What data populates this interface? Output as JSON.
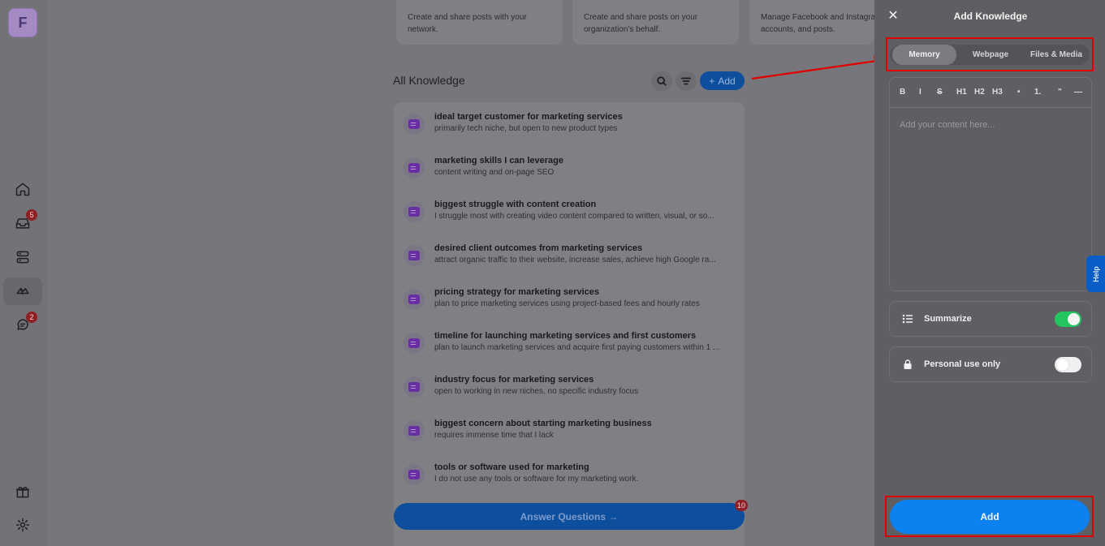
{
  "rail": {
    "logo_letter": "F",
    "inbox_badge": "5",
    "chat_badge": "2"
  },
  "cards": [
    {
      "text": "Create and share posts with your network."
    },
    {
      "text": "Create and share posts on your organization's behalf."
    },
    {
      "text": "Manage Facebook and Instagram pages, accounts, and posts."
    }
  ],
  "knowledge": {
    "title": "All Knowledge",
    "add_label": "Add",
    "items": [
      {
        "title": "ideal target customer for marketing services",
        "subtitle": "primarily tech niche, but open to new product types"
      },
      {
        "title": "marketing skills I can leverage",
        "subtitle": "content writing and on-page SEO"
      },
      {
        "title": "biggest struggle with content creation",
        "subtitle": "I struggle most with creating video content compared to written, visual, or so..."
      },
      {
        "title": "desired client outcomes from marketing services",
        "subtitle": "attract organic traffic to their website, increase sales, achieve high Google ra..."
      },
      {
        "title": "pricing strategy for marketing services",
        "subtitle": "plan to price marketing services using project-based fees and hourly rates"
      },
      {
        "title": "timeline for launching marketing services and first customers",
        "subtitle": "plan to launch marketing services and acquire first paying customers within 1 ..."
      },
      {
        "title": "industry focus for marketing services",
        "subtitle": "open to working in new niches, no specific industry focus"
      },
      {
        "title": "biggest concern about starting marketing business",
        "subtitle": "requires immense time that I lack"
      },
      {
        "title": "tools or software used for marketing",
        "subtitle": "I do not use any tools or software for my marketing work."
      }
    ],
    "answer_label": "Answer Questions →",
    "answer_badge": "10"
  },
  "panel": {
    "title": "Add Knowledge",
    "tabs": [
      {
        "label": "Memory",
        "active": true
      },
      {
        "label": "Webpage",
        "active": false
      },
      {
        "label": "Files & Media",
        "active": false
      }
    ],
    "toolbar": [
      "B",
      "I",
      "S",
      "H1",
      "H2",
      "H3",
      "•",
      "1.",
      "\"",
      "—"
    ],
    "editor_placeholder": "Add your content here...",
    "summarize": {
      "label": "Summarize",
      "on": true
    },
    "personal": {
      "label": "Personal use only",
      "on": false
    },
    "submit_label": "Add"
  },
  "help_label": "Help",
  "colors": {
    "accent": "#0b82f0",
    "toggle_on": "#22c55e",
    "annotation": "#e00000"
  }
}
